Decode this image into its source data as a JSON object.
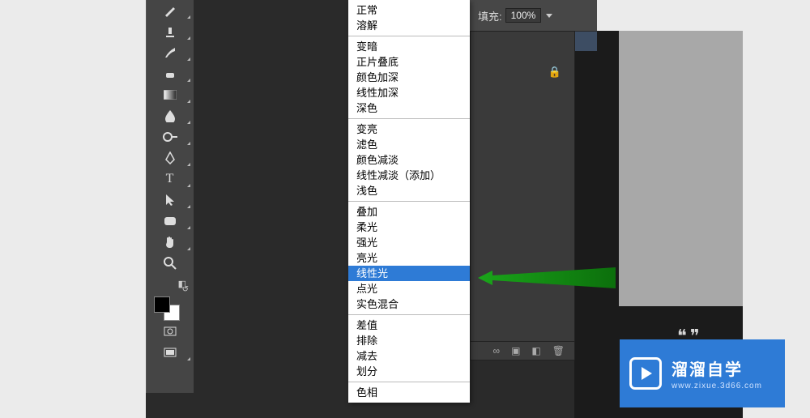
{
  "toolbar": {
    "tools": [
      "heal-brush",
      "stamp",
      "history-brush",
      "eraser",
      "gradient",
      "blur",
      "dodge",
      "pen",
      "type",
      "path-select",
      "rectangle",
      "hand",
      "zoom"
    ]
  },
  "blend_menu": {
    "groups": [
      [
        "正常",
        "溶解"
      ],
      [
        "变暗",
        "正片叠底",
        "颜色加深",
        "线性加深",
        "深色"
      ],
      [
        "变亮",
        "滤色",
        "颜色减淡",
        "线性减淡（添加）",
        "浅色"
      ],
      [
        "叠加",
        "柔光",
        "强光",
        "亮光",
        "线性光",
        "点光",
        "实色混合"
      ],
      [
        "差值",
        "排除",
        "减去",
        "划分"
      ],
      [
        "色相"
      ]
    ],
    "highlight": "线性光"
  },
  "options_bar": {
    "fill_label": "填充:",
    "fill_value": "100%"
  },
  "panel_icons": {
    "lock": "🔒",
    "fx": "∞",
    "folder": "▣",
    "mask": "◧",
    "trash": "🗑"
  },
  "watermark": {
    "title": "溜溜自学",
    "subtitle": "www.zixue.3d66.com"
  },
  "ghost": "❝❞",
  "colors": {
    "accent": "#2e7bd6",
    "highlight": "#2e7bd6",
    "arrow": "#1aa51a"
  }
}
